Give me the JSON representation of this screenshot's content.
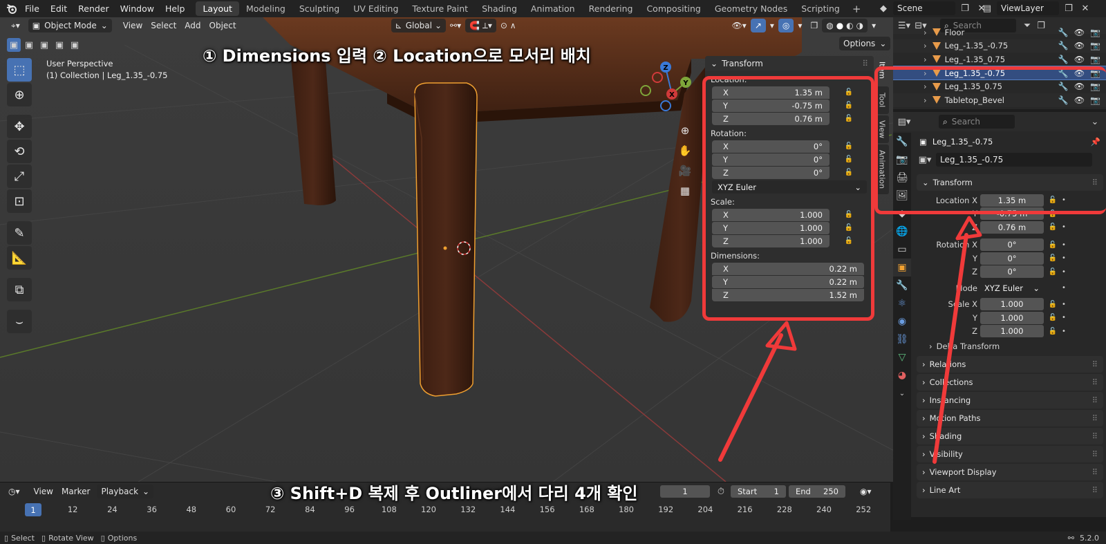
{
  "menu": {
    "items": [
      "File",
      "Edit",
      "Render",
      "Window",
      "Help"
    ]
  },
  "workspaces": [
    "Layout",
    "Modeling",
    "Sculpting",
    "UV Editing",
    "Texture Paint",
    "Shading",
    "Animation",
    "Rendering",
    "Compositing",
    "Geometry Nodes",
    "Scripting"
  ],
  "scene": {
    "name": "Scene",
    "view_layer": "ViewLayer"
  },
  "viewport_header": {
    "mode": "Object Mode",
    "menus": [
      "View",
      "Select",
      "Add",
      "Object"
    ],
    "orientation": "Global",
    "options_label": "Options"
  },
  "viewport": {
    "perspective": "User Perspective",
    "collection_line": "(1) Collection | Leg_1.35_-0.75"
  },
  "annotations": {
    "top": "① Dimensions 입력  ② Location으로 모서리 배치",
    "bottom": "③ Shift+D 복제 후 Outliner에서 다리 4개 확인"
  },
  "npanel": {
    "title": "Transform",
    "location_label": "Location:",
    "location": [
      {
        "axis": "X",
        "value": "1.35 m"
      },
      {
        "axis": "Y",
        "value": "-0.75 m"
      },
      {
        "axis": "Z",
        "value": "0.76 m"
      }
    ],
    "rotation_label": "Rotation:",
    "rotation": [
      {
        "axis": "X",
        "value": "0°"
      },
      {
        "axis": "Y",
        "value": "0°"
      },
      {
        "axis": "Z",
        "value": "0°"
      }
    ],
    "rotation_mode": "XYZ Euler",
    "scale_label": "Scale:",
    "scale": [
      {
        "axis": "X",
        "value": "1.000"
      },
      {
        "axis": "Y",
        "value": "1.000"
      },
      {
        "axis": "Z",
        "value": "1.000"
      }
    ],
    "dimensions_label": "Dimensions:",
    "dimensions": [
      {
        "axis": "X",
        "value": "0.22 m"
      },
      {
        "axis": "Y",
        "value": "0.22 m"
      },
      {
        "axis": "Z",
        "value": "1.52 m"
      }
    ],
    "side_tabs": [
      "Item",
      "Tool",
      "View",
      "Animation"
    ]
  },
  "gizmo": {
    "x": "X",
    "y": "Y",
    "z": "Z"
  },
  "outliner": {
    "search_placeholder": "Search",
    "rows": [
      {
        "name": "Floor",
        "selected": false
      },
      {
        "name": "Leg_-1.35_-0.75",
        "selected": false
      },
      {
        "name": "Leg_-1.35_0.75",
        "selected": false
      },
      {
        "name": "Leg_1.35_-0.75",
        "selected": true
      },
      {
        "name": "Leg_1.35_0.75",
        "selected": false
      },
      {
        "name": "Tabletop_Bevel",
        "selected": false
      }
    ]
  },
  "properties": {
    "search_placeholder": "Search",
    "object_name": "Leg_1.35_-0.75",
    "object_field": "Leg_1.35_-0.75",
    "transform_title": "Transform",
    "location": [
      {
        "label": "Location X",
        "value": "1.35 m"
      },
      {
        "label": "Y",
        "value": "-0.75 m"
      },
      {
        "label": "Z",
        "value": "0.76 m"
      }
    ],
    "rotation": [
      {
        "label": "Rotation X",
        "value": "0°"
      },
      {
        "label": "Y",
        "value": "0°"
      },
      {
        "label": "Z",
        "value": "0°"
      }
    ],
    "mode_label": "Mode",
    "mode_value": "XYZ Euler",
    "scale": [
      {
        "label": "Scale X",
        "value": "1.000"
      },
      {
        "label": "Y",
        "value": "1.000"
      },
      {
        "label": "Z",
        "value": "1.000"
      }
    ],
    "delta_transform": "Delta Transform",
    "sections": [
      "Relations",
      "Collections",
      "Instancing",
      "Motion Paths",
      "Shading",
      "Visibility",
      "Viewport Display",
      "Line Art"
    ]
  },
  "timeline": {
    "menus": [
      "View",
      "Marker"
    ],
    "playback": "Playback",
    "current_frame": "1",
    "start_label": "Start",
    "start": "1",
    "end_label": "End",
    "end": "250",
    "frames": [
      "1",
      "12",
      "24",
      "36",
      "48",
      "60",
      "72",
      "84",
      "96",
      "108",
      "120",
      "132",
      "144",
      "156",
      "168",
      "180",
      "192",
      "204",
      "216",
      "228",
      "240",
      "252"
    ]
  },
  "statusbar": {
    "select": "Select",
    "rotate": "Rotate View",
    "options": "Options",
    "version": "5.2.0"
  },
  "colors": {
    "accent": "#4772b3",
    "annotation_red": "#f03a3a",
    "selection_orange": "#f0a030",
    "wood": "#4a2616"
  }
}
